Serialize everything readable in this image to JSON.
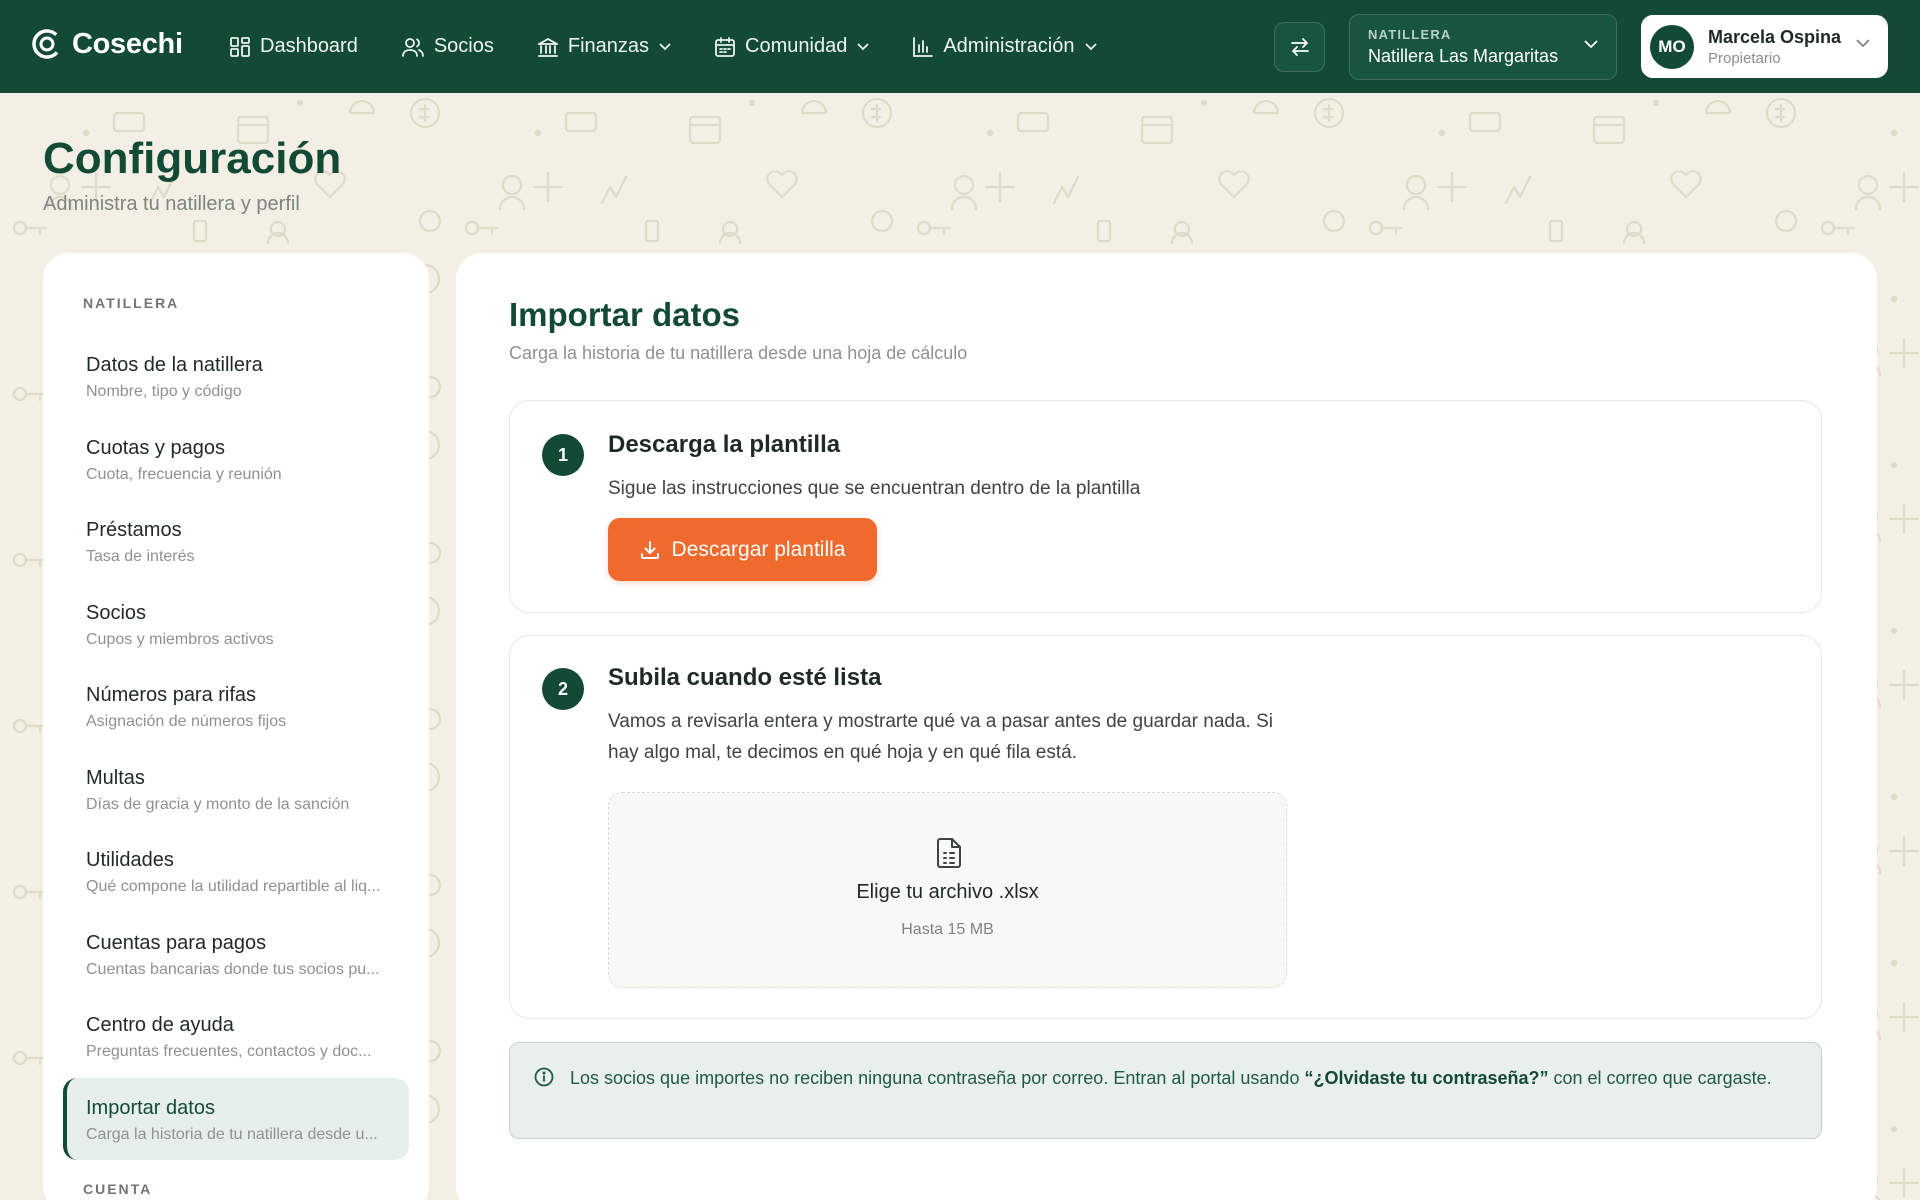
{
  "colors": {
    "brand_green": "#134a36",
    "accent_orange": "#ef6a2c",
    "background": "#f3efe4",
    "notice_bg": "#e9efeb"
  },
  "topbar": {
    "brand": "Cosechi",
    "nav": [
      {
        "label": "Dashboard",
        "icon": "dashboard-grid-icon",
        "has_menu": false
      },
      {
        "label": "Socios",
        "icon": "users-icon",
        "has_menu": false
      },
      {
        "label": "Finanzas",
        "icon": "bank-icon",
        "has_menu": true
      },
      {
        "label": "Comunidad",
        "icon": "calendar-icon",
        "has_menu": true
      },
      {
        "label": "Administración",
        "icon": "bar-chart-icon",
        "has_menu": true
      }
    ],
    "org_selector": {
      "label": "NATILLERA",
      "value": "Natillera Las Margaritas"
    },
    "user": {
      "initials": "MO",
      "name": "Marcela Ospina",
      "role": "Propietario"
    }
  },
  "page": {
    "title": "Configuración",
    "subtitle": "Administra tu natillera y perfil"
  },
  "sidebar": {
    "section_natillera": "NATILLERA",
    "items": [
      {
        "label": "Datos de la natillera",
        "desc": "Nombre, tipo y código"
      },
      {
        "label": "Cuotas y pagos",
        "desc": "Cuota, frecuencia y reunión"
      },
      {
        "label": "Préstamos",
        "desc": "Tasa de interés"
      },
      {
        "label": "Socios",
        "desc": "Cupos y miembros activos"
      },
      {
        "label": "Números para rifas",
        "desc": "Asignación de números fijos"
      },
      {
        "label": "Multas",
        "desc": "Días de gracia y monto de la sanción"
      },
      {
        "label": "Utilidades",
        "desc": "Qué compone la utilidad repartible al liq..."
      },
      {
        "label": "Cuentas para pagos",
        "desc": "Cuentas bancarias donde tus socios pu..."
      },
      {
        "label": "Centro de ayuda",
        "desc": "Preguntas frecuentes, contactos y doc..."
      },
      {
        "label": "Importar datos",
        "desc": "Carga la historia de tu natillera desde u...",
        "active": true
      }
    ],
    "section_cuenta": "CUENTA"
  },
  "main": {
    "title": "Importar datos",
    "subtitle": "Carga la historia de tu natillera desde una hoja de cálculo",
    "step1": {
      "number": "1",
      "title": "Descarga la plantilla",
      "text": "Sigue las instrucciones que se encuentran dentro de la plantilla",
      "button": "Descargar plantilla"
    },
    "step2": {
      "number": "2",
      "title": "Subila cuando esté lista",
      "text_line1": "Vamos a revisarla entera y mostrarte qué va a pasar antes de guardar nada. Si",
      "text_line2": "hay algo mal, te decimos en qué hoja y en qué fila está.",
      "dropzone_title": "Elige tu archivo .xlsx",
      "dropzone_sub": "Hasta 15 MB"
    },
    "notice": {
      "before": "Los socios que importes no reciben ninguna contraseña por correo. Entran al portal usando ",
      "emphasis": "“¿Olvidaste tu contraseña?”",
      "after": " con el correo que cargaste."
    }
  }
}
